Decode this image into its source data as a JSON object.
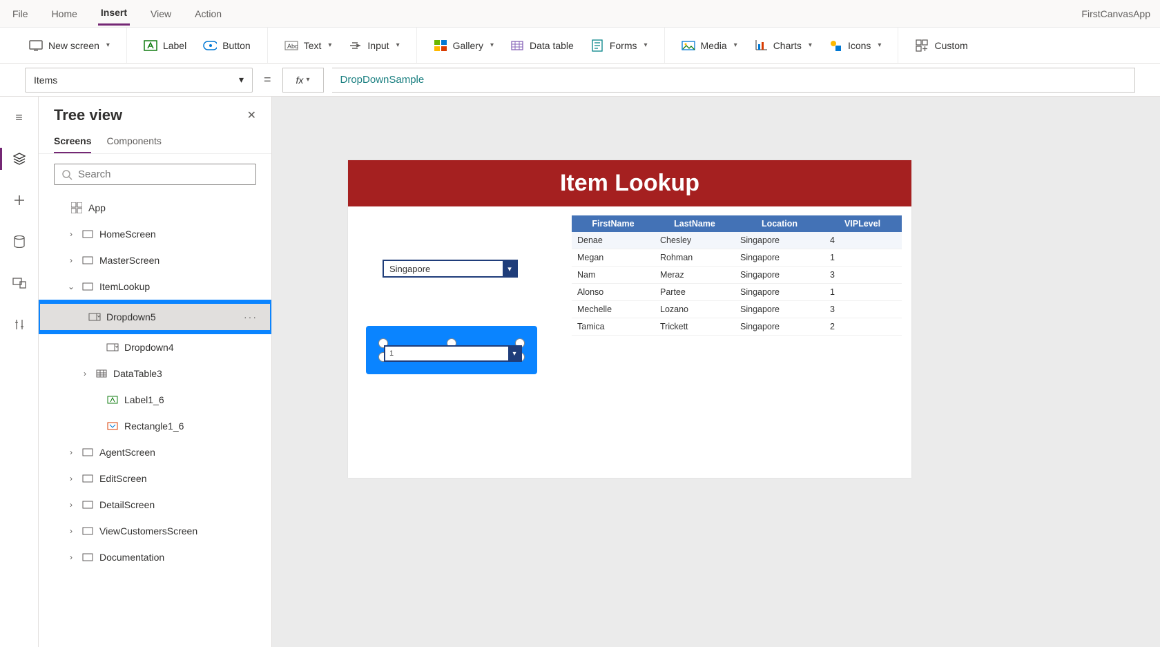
{
  "app_title": "FirstCanvasApp",
  "menu": {
    "file": "File",
    "home": "Home",
    "insert": "Insert",
    "view": "View",
    "action": "Action"
  },
  "ribbon": {
    "new_screen": "New screen",
    "label": "Label",
    "button": "Button",
    "text": "Text",
    "input": "Input",
    "gallery": "Gallery",
    "data_table": "Data table",
    "forms": "Forms",
    "media": "Media",
    "charts": "Charts",
    "icons": "Icons",
    "custom": "Custom"
  },
  "formula": {
    "property": "Items",
    "value": "DropDownSample",
    "fx": "fx"
  },
  "tree": {
    "title": "Tree view",
    "tab_screens": "Screens",
    "tab_components": "Components",
    "search_placeholder": "Search",
    "app": "App",
    "nodes": {
      "home": "HomeScreen",
      "master": "MasterScreen",
      "itemlookup": "ItemLookup",
      "dropdown5": "Dropdown5",
      "dropdown4": "Dropdown4",
      "datatable3": "DataTable3",
      "label1_6": "Label1_6",
      "rectangle1_6": "Rectangle1_6",
      "agent": "AgentScreen",
      "edit": "EditScreen",
      "detail": "DetailScreen",
      "viewcust": "ViewCustomersScreen",
      "doc": "Documentation"
    }
  },
  "canvas": {
    "header": "Item Lookup",
    "dropdown1_value": "Singapore",
    "dropdown2_value": "1",
    "table": {
      "headers": {
        "fn": "FirstName",
        "ln": "LastName",
        "loc": "Location",
        "vl": "VIPLevel"
      },
      "rows": [
        {
          "fn": "Denae",
          "ln": "Chesley",
          "loc": "Singapore",
          "vl": "4"
        },
        {
          "fn": "Megan",
          "ln": "Rohman",
          "loc": "Singapore",
          "vl": "1"
        },
        {
          "fn": "Nam",
          "ln": "Meraz",
          "loc": "Singapore",
          "vl": "3"
        },
        {
          "fn": "Alonso",
          "ln": "Partee",
          "loc": "Singapore",
          "vl": "1"
        },
        {
          "fn": "Mechelle",
          "ln": "Lozano",
          "loc": "Singapore",
          "vl": "3"
        },
        {
          "fn": "Tamica",
          "ln": "Trickett",
          "loc": "Singapore",
          "vl": "2"
        }
      ]
    }
  }
}
